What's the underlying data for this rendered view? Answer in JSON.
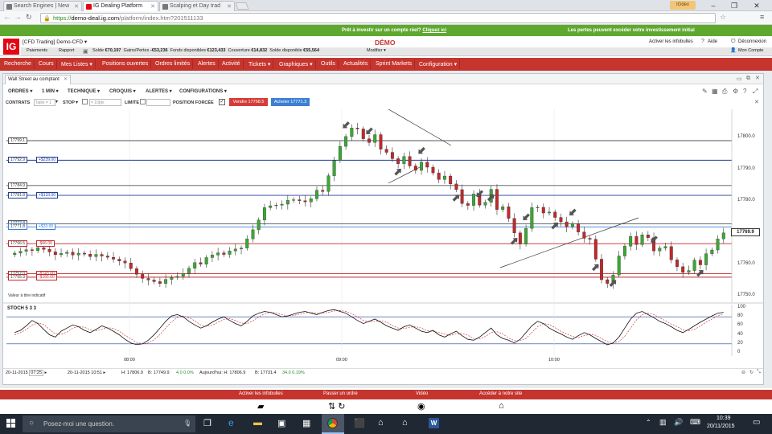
{
  "browser": {
    "tabs": [
      {
        "label": "Search Engines | New"
      },
      {
        "label": "IG Dealing Platform"
      },
      {
        "label": "Scalping et Day trad"
      }
    ],
    "user_badge": "IGdex",
    "url_prefix": "https://",
    "url_host": "demo-deal.ig.com",
    "url_path": "/platform/index.htm?201511133"
  },
  "promo": {
    "center_text": "Prêt à investir sur un compte réel?",
    "center_link": "Cliquez ici",
    "right_text": "Les pertes peuvent excéder votre investissement initial"
  },
  "header": {
    "logo_text": "IG",
    "account_name": "[CFD Trading] Demo-CFD",
    "mode": "DÉMO",
    "links": [
      "Activer les infobulles",
      "Aide",
      "Déconnexion"
    ],
    "account_link": "Mon Compte",
    "sub_links": [
      "Paiements",
      "Rapport"
    ],
    "balances": [
      {
        "label": "Solde",
        "value": "€70,197"
      },
      {
        "label": "Gains/Pertes",
        "value": "-€53,236"
      },
      {
        "label": "Fonds disponibles",
        "value": "€123,433"
      },
      {
        "label": "Couverture",
        "value": "€14,832"
      },
      {
        "label": "Solde disponible",
        "value": "€55,564"
      }
    ],
    "modify": "Modifier"
  },
  "nav": [
    "Recherche",
    "Cours",
    "Mes Listes",
    "Positions ouvertes",
    "Ordres limités",
    "Alertes",
    "Activité",
    "Tickets",
    "Graphiques",
    "Outils",
    "Actualités",
    "Sprint Markets",
    "Configuration"
  ],
  "panel": {
    "tab_title": "Wall Street au comptant",
    "toolbar": [
      "ORDRES",
      "1 MIN",
      "TECHNIQUE",
      "CROQUIS",
      "ALERTES",
      "CONFIGURATIONS"
    ],
    "ticket": {
      "contrats_label": "CONTRATS",
      "size_placeholder": "Taille = 1",
      "stop_label": "STOP",
      "stop_placeholder": "= 10pts",
      "limite_label": "LIMITE",
      "position_label": "POSITION FORCÉE",
      "sell_label": "Vendre 17768.5",
      "buy_label": "Acheter 17771.3"
    },
    "stoch_label": "STOCH 5 3 3",
    "indicative_note": "Valeur à titre indicatif",
    "date_start": "20-11-2015",
    "time_start": "07:25",
    "date_end": "20-11-2015 10:51",
    "stats": [
      {
        "text": "H: 17806.9"
      },
      {
        "text": "B: 17749.9"
      },
      {
        "text": "4.0 0.0%"
      },
      {
        "text": "Aujourd'hui: H: 17806.9"
      },
      {
        "text": "B: 17731.4"
      },
      {
        "text": "34.0 0.19%"
      }
    ]
  },
  "chart_data": {
    "type": "candlestick",
    "y_ticks": [
      "17800.0",
      "17790.0",
      "17780.0",
      "17770.0",
      "17760.0",
      "17750.0"
    ],
    "ylim": [
      17749,
      17808
    ],
    "x_ticks": [
      "08:00",
      "09:00",
      "10:00"
    ],
    "stoch_ticks": [
      "100",
      "80",
      "60",
      "40",
      "20",
      "0"
    ],
    "current_price": "17769.9",
    "levels": [
      {
        "price": 17799.1,
        "label": "17799.1",
        "pl": "",
        "color": "#555555"
      },
      {
        "price": 17792.9,
        "label": "17792.9",
        "pl": "+$239.00",
        "color": "#1f3f9a"
      },
      {
        "price": 17784.9,
        "label": "17784.9",
        "pl": "",
        "color": "#555555"
      },
      {
        "price": 17781.8,
        "label": "17781.8",
        "pl": "+$133.00",
        "color": "#1f3f9a"
      },
      {
        "price": 17772.8,
        "label": "17772.8",
        "pl": "",
        "color": "#555555"
      },
      {
        "price": 17771.8,
        "label": "17771.8",
        "pl": "+$33.00",
        "color": "#3a7fd9"
      },
      {
        "price": 17766.5,
        "label": "17766.5",
        "pl": "-$66.00",
        "color": "#c0292c"
      },
      {
        "price": 17757.0,
        "label": "17757.0",
        "pl": "-$143.00",
        "color": "#c0292c"
      },
      {
        "price": 17755.9,
        "label": "17755.9",
        "pl": "-$166.00",
        "color": "#c0292c"
      }
    ],
    "close_series": [
      17763.5,
      17764.1,
      17764.6,
      17764.3,
      17765.2,
      17764.7,
      17763.9,
      17763.0,
      17763.4,
      17763.8,
      17762.9,
      17763.5,
      17763.2,
      17762.4,
      17763.1,
      17762.6,
      17762.2,
      17761.6,
      17761.0,
      17760.4,
      17758.6,
      17756.8,
      17755.5,
      17755.0,
      17754.5,
      17753.9,
      17755.2,
      17755.8,
      17756.2,
      17757.1,
      17758.7,
      17760.5,
      17760.0,
      17762.1,
      17762.9,
      17763.6,
      17763.1,
      17764.2,
      17764.8,
      17765.1,
      17768.0,
      17770.9,
      17774.0,
      17777.9,
      17778.5,
      17778.7,
      17779.0,
      17780.2,
      17780.4,
      17780.1,
      17779.7,
      17780.7,
      17783.4,
      17783.0,
      17788.0,
      17792.8,
      17797.3,
      17800.4,
      17803.1,
      17802.8,
      17799.7,
      17798.5,
      17801.0,
      17796.4,
      17795.4,
      17793.4,
      17791.8,
      17794.1,
      17791.1,
      17789.7,
      17792.3,
      17790.7,
      17788.9,
      17786.8,
      17787.9,
      17785.4,
      17783.6,
      17779.2,
      17778.6,
      17782.2,
      17778.7,
      17779.6,
      17783.7,
      17777.3,
      17778.2,
      17774.5,
      17769.9,
      17766.4,
      17771.3,
      17777.9,
      17778.0,
      17776.2,
      17776.5,
      17774.8,
      17773.4,
      17771.8,
      17772.8,
      17770.2,
      17768.2,
      17767.9,
      17761.6,
      17755.1,
      17753.9,
      17756.6,
      17762.6,
      17765.7,
      17768.8,
      17766.2,
      17769.3,
      17768.4,
      17764.2,
      17765.1,
      17765.6,
      17761.4,
      17759.2,
      17757.4,
      17758.0,
      17761.3,
      17759.8,
      17763.3,
      17764.5,
      17768.0,
      17769.9
    ],
    "stoch_k": [
      45,
      50,
      60,
      72,
      65,
      52,
      40,
      35,
      48,
      55,
      62,
      58,
      50,
      45,
      52,
      60,
      55,
      48,
      40,
      30,
      22,
      18,
      20,
      28,
      40,
      55,
      70,
      82,
      85,
      80,
      70,
      62,
      55,
      60,
      68,
      75,
      80,
      72,
      65,
      60,
      70,
      82,
      88,
      92,
      90,
      85,
      80,
      82,
      86,
      90,
      92,
      88,
      85,
      90,
      94,
      96,
      92,
      88,
      80,
      72,
      65,
      70,
      75,
      68,
      60,
      55,
      50,
      58,
      62,
      55,
      48,
      45,
      50,
      40,
      35,
      42,
      48,
      38,
      30,
      28,
      35,
      45,
      55,
      40,
      32,
      28,
      22,
      30,
      45,
      60,
      70,
      65,
      55,
      48,
      42,
      35,
      30,
      38,
      45,
      40,
      32,
      25,
      18,
      22,
      35,
      55,
      75,
      88,
      92,
      85,
      78,
      70,
      65,
      58,
      50,
      45,
      52,
      60,
      68,
      75,
      82,
      88,
      90
    ],
    "stoch_d": [
      40,
      45,
      52,
      62,
      66,
      63,
      52,
      42,
      41,
      46,
      55,
      58,
      57,
      51,
      49,
      52,
      56,
      54,
      48,
      39,
      31,
      23,
      20,
      22,
      29,
      41,
      55,
      69,
      79,
      82,
      78,
      71,
      62,
      59,
      61,
      68,
      74,
      76,
      72,
      66,
      65,
      71,
      80,
      87,
      90,
      89,
      85,
      82,
      83,
      86,
      89,
      90,
      88,
      88,
      90,
      93,
      94,
      92,
      87,
      80,
      72,
      69,
      70,
      71,
      68,
      61,
      55,
      54,
      57,
      58,
      55,
      49,
      48,
      45,
      42,
      39,
      42,
      43,
      39,
      32,
      31,
      36,
      45,
      47,
      42,
      33,
      27,
      27,
      32,
      45,
      58,
      65,
      63,
      56,
      48,
      42,
      36,
      34,
      38,
      41,
      39,
      32,
      25,
      22,
      25,
      37,
      55,
      73,
      85,
      88,
      85,
      78,
      71,
      64,
      58,
      51,
      49,
      52,
      60,
      68,
      75,
      82,
      87
    ]
  },
  "bottom": {
    "actions": [
      "Activer les infobulles",
      "Passer un ordre",
      "Vidéo",
      "Accéder à notre site"
    ]
  },
  "taskbar": {
    "search_placeholder": "Posez-moi une question.",
    "time": "10:39",
    "date": "20/11/2015"
  }
}
